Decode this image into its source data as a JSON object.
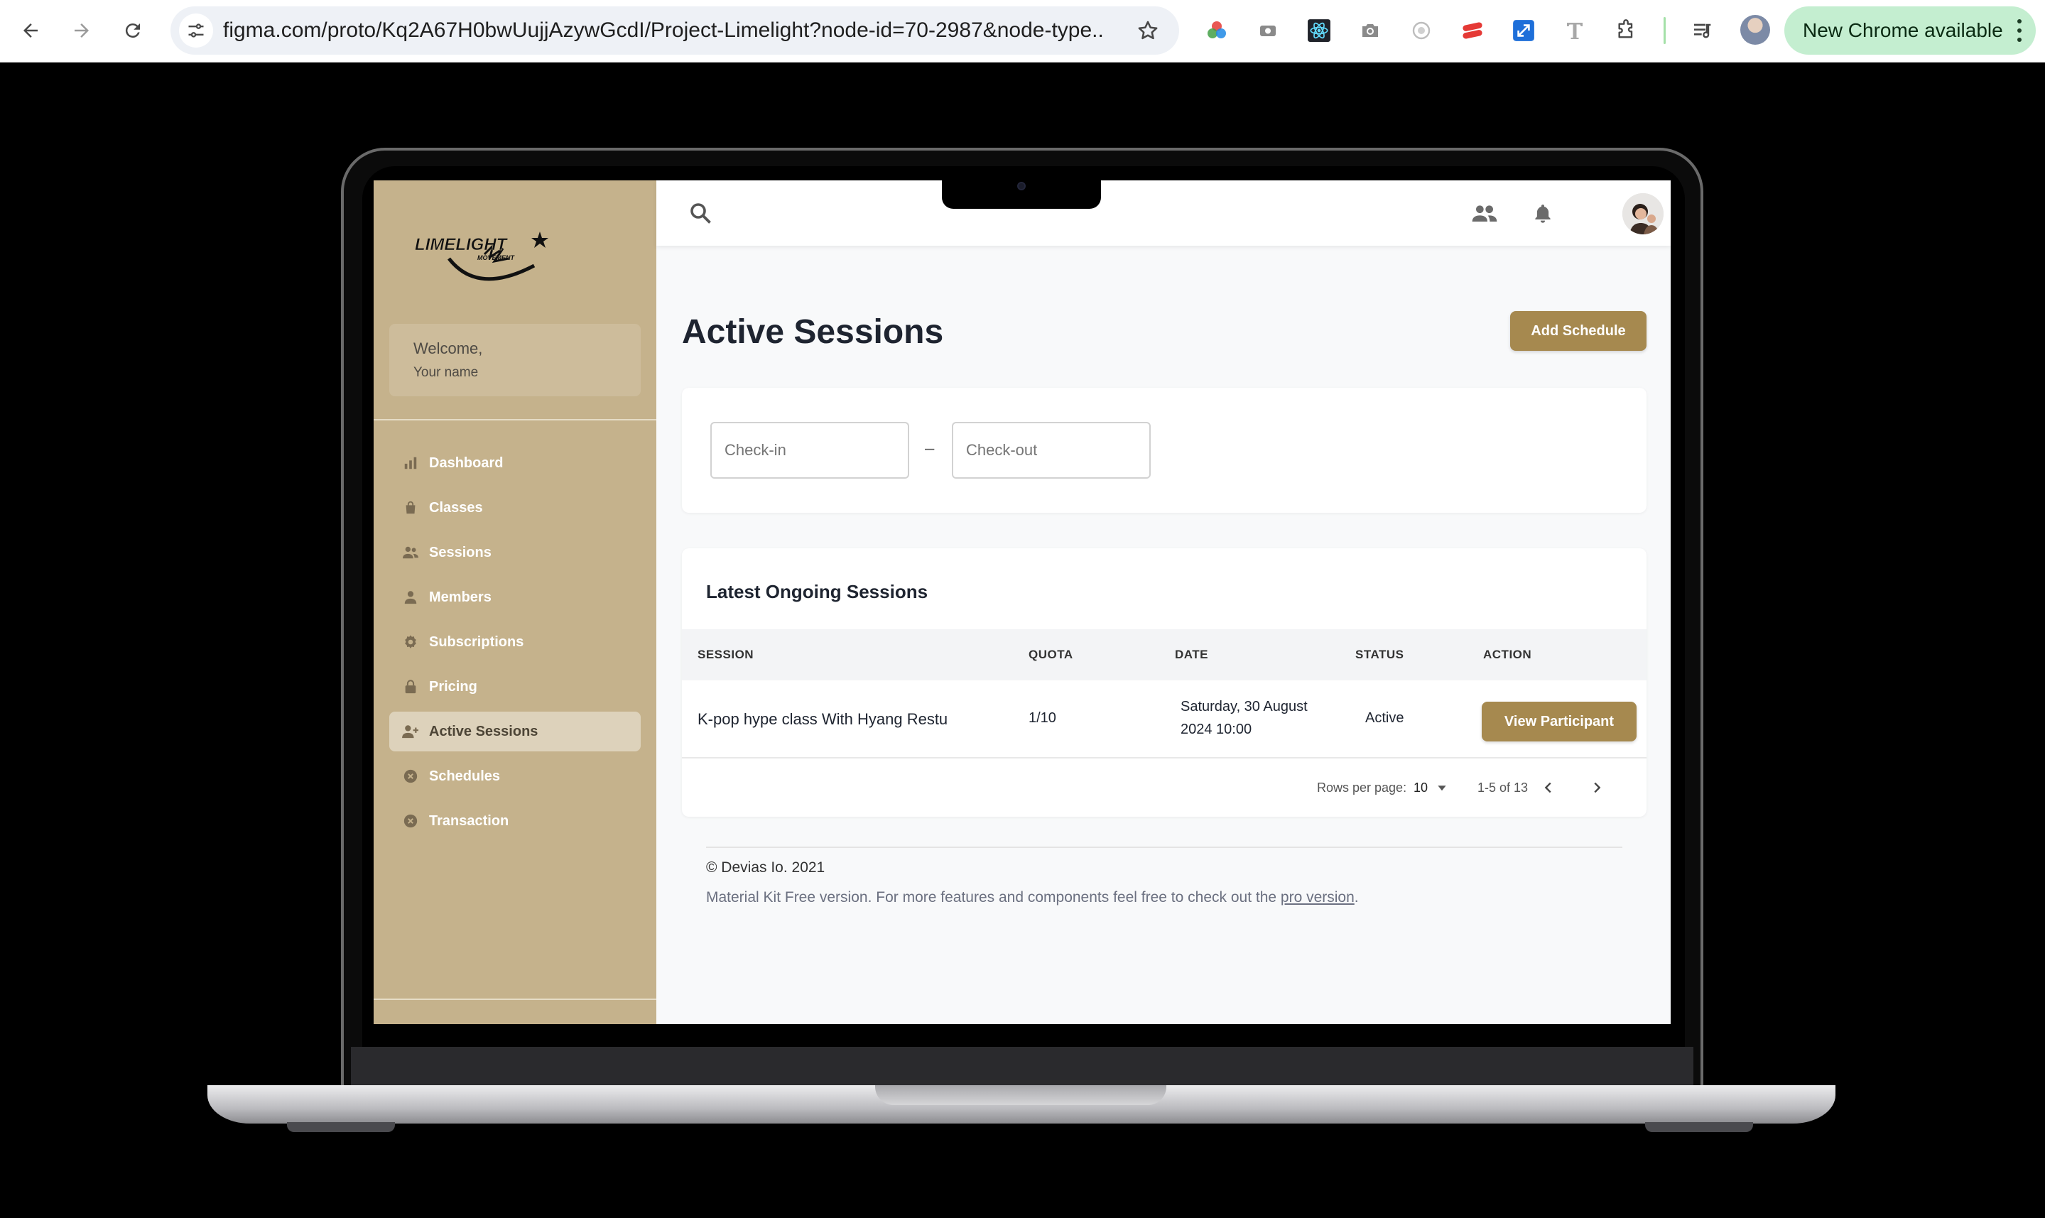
{
  "browser": {
    "url": "figma.com/proto/Kq2A67H0bwUujjAzywGcdI/Project-Limelight?node-id=70-2987&node-type...",
    "update_label": "New Chrome available"
  },
  "sidebar": {
    "welcome_title": "Welcome,",
    "welcome_name": "Your name",
    "items": [
      {
        "label": "Dashboard",
        "icon": "bar-chart-icon"
      },
      {
        "label": "Classes",
        "icon": "shopping-bag-icon"
      },
      {
        "label": "Sessions",
        "icon": "users-icon"
      },
      {
        "label": "Members",
        "icon": "user-icon"
      },
      {
        "label": "Subscriptions",
        "icon": "gear-icon"
      },
      {
        "label": "Pricing",
        "icon": "lock-icon"
      },
      {
        "label": "Active Sessions",
        "icon": "user-add-icon",
        "active": true
      },
      {
        "label": "Schedules",
        "icon": "x-circle-icon"
      },
      {
        "label": "Transaction",
        "icon": "x-circle-icon"
      }
    ]
  },
  "main": {
    "title": "Active Sessions",
    "add_button": "Add Schedule",
    "filter": {
      "checkin_placeholder": "Check-in",
      "separator": "–",
      "checkout_placeholder": "Check-out"
    },
    "table": {
      "title": "Latest Ongoing Sessions",
      "columns": [
        "SESSION",
        "QUOTA",
        "DATE",
        "STATUS",
        "ACTION"
      ],
      "rows": [
        {
          "session": "K-pop hype class With Hyang Restu",
          "quota": "1/10",
          "date_line1": "Saturday, 30 August",
          "date_line2": "2024 10:00",
          "status": "Active",
          "action": "View Participant"
        }
      ],
      "pagination": {
        "rows_per_page_label": "Rows per page:",
        "rows_per_page_value": "10",
        "range": "1-5 of 13"
      }
    },
    "footer": {
      "copyright": "© Devias Io. 2021",
      "text": "Material Kit Free version. For more features and components feel free to check out the ",
      "link": "pro version",
      "end": "."
    }
  },
  "colors": {
    "sidebar_bg": "#c5b28c",
    "accent": "#a6894f",
    "active_item_bg": "#ddd2bb",
    "update_pill": "#c4eed0"
  }
}
